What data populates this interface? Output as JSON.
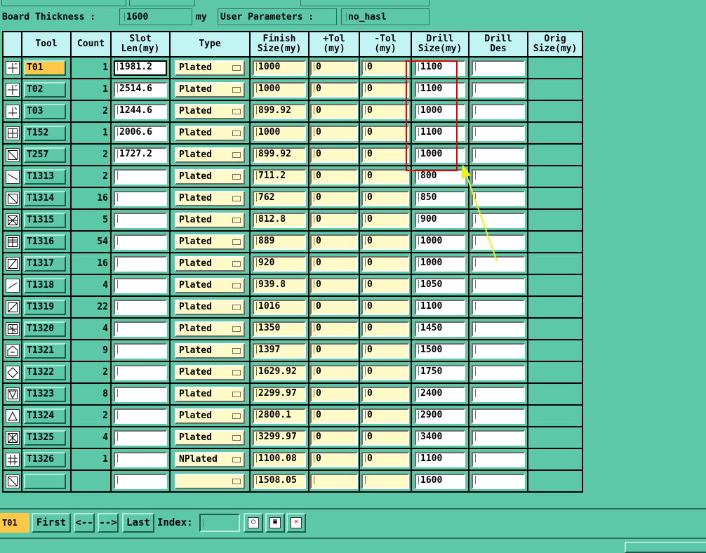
{
  "params": {
    "board_thickness_label": "Board Thickness :",
    "board_thickness_value": "1600",
    "board_thickness_unit": "my",
    "user_params_label": "User Parameters :",
    "user_params_value": "no_hasl"
  },
  "columns": [
    "",
    "Tool",
    "Count",
    "Slot\nLen(my)",
    "Type",
    "Finish\nSize(my)",
    "+Tol\n(my)",
    "-Tol\n(my)",
    "Drill\nSize(my)",
    "Drill\nDes",
    "Orig\nSize(my)"
  ],
  "rows": [
    {
      "icon": "crosshair-icon",
      "tool": "T01",
      "count": "1",
      "slot": "1981.2",
      "type": "Plated",
      "finish": "1000",
      "ptol": "0",
      "mtol": "0",
      "drill": "1100",
      "des": "",
      "selected": true
    },
    {
      "icon": "crosshair-icon",
      "tool": "T02",
      "count": "1",
      "slot": "2514.6",
      "type": "Plated",
      "finish": "1000",
      "ptol": "0",
      "mtol": "0",
      "drill": "1100",
      "des": ""
    },
    {
      "icon": "corner-icon",
      "tool": "T03",
      "count": "2",
      "slot": "1244.6",
      "type": "Plated",
      "finish": "899.92",
      "ptol": "0",
      "mtol": "0",
      "drill": "1000",
      "des": ""
    },
    {
      "icon": "box-cross-icon",
      "tool": "T152",
      "count": "1",
      "slot": "2006.6",
      "type": "Plated",
      "finish": "1000",
      "ptol": "0",
      "mtol": "0",
      "drill": "1100",
      "des": ""
    },
    {
      "icon": "diag-icon",
      "tool": "T257",
      "count": "2",
      "slot": "1727.2",
      "type": "Plated",
      "finish": "899.92",
      "ptol": "0",
      "mtol": "0",
      "drill": "1000",
      "des": ""
    },
    {
      "icon": "slash-icon",
      "tool": "T1313",
      "count": "2",
      "slot": "",
      "type": "Plated",
      "finish": "711.2",
      "ptol": "0",
      "mtol": "0",
      "drill": "800",
      "des": ""
    },
    {
      "icon": "box-diag-icon",
      "tool": "T1314",
      "count": "16",
      "slot": "",
      "type": "Plated",
      "finish": "762",
      "ptol": "0",
      "mtol": "0",
      "drill": "850",
      "des": ""
    },
    {
      "icon": "box-x-icon",
      "tool": "T1315",
      "count": "5",
      "slot": "",
      "type": "Plated",
      "finish": "812.8",
      "ptol": "0",
      "mtol": "0",
      "drill": "900",
      "des": ""
    },
    {
      "icon": "box-grid-icon",
      "tool": "T1316",
      "count": "54",
      "slot": "",
      "type": "Plated",
      "finish": "889",
      "ptol": "0",
      "mtol": "0",
      "drill": "1000",
      "des": ""
    },
    {
      "icon": "slash-up-icon",
      "tool": "T1317",
      "count": "16",
      "slot": "",
      "type": "Plated",
      "finish": "920",
      "ptol": "0",
      "mtol": "0",
      "drill": "1000",
      "des": ""
    },
    {
      "icon": "line-icon",
      "tool": "T1318",
      "count": "4",
      "slot": "",
      "type": "Plated",
      "finish": "939.8",
      "ptol": "0",
      "mtol": "0",
      "drill": "1050",
      "des": ""
    },
    {
      "icon": "box-slash-icon",
      "tool": "T1319",
      "count": "22",
      "slot": "",
      "type": "Plated",
      "finish": "1016",
      "ptol": "0",
      "mtol": "0",
      "drill": "1100",
      "des": ""
    },
    {
      "icon": "box-plus-icon",
      "tool": "T1320",
      "count": "4",
      "slot": "",
      "type": "Plated",
      "finish": "1350",
      "ptol": "0",
      "mtol": "0",
      "drill": "1450",
      "des": ""
    },
    {
      "icon": "house-icon",
      "tool": "T1321",
      "count": "9",
      "slot": "",
      "type": "Plated",
      "finish": "1397",
      "ptol": "0",
      "mtol": "0",
      "drill": "1500",
      "des": ""
    },
    {
      "icon": "diamond-icon",
      "tool": "T1322",
      "count": "2",
      "slot": "",
      "type": "Plated",
      "finish": "1629.92",
      "ptol": "0",
      "mtol": "0",
      "drill": "1750",
      "des": ""
    },
    {
      "icon": "triangle-down-icon",
      "tool": "T1323",
      "count": "8",
      "slot": "",
      "type": "Plated",
      "finish": "2299.97",
      "ptol": "0",
      "mtol": "0",
      "drill": "2400",
      "des": ""
    },
    {
      "icon": "triangle-up-icon",
      "tool": "T1324",
      "count": "2",
      "slot": "",
      "type": "Plated",
      "finish": "2800.1",
      "ptol": "0",
      "mtol": "0",
      "drill": "2900",
      "des": ""
    },
    {
      "icon": "star-icon",
      "tool": "T1325",
      "count": "4",
      "slot": "",
      "type": "Plated",
      "finish": "3299.97",
      "ptol": "0",
      "mtol": "0",
      "drill": "3400",
      "des": ""
    },
    {
      "icon": "hash-icon",
      "tool": "T1326",
      "count": "1",
      "slot": "",
      "type": "NPlated",
      "finish": "1100.08",
      "ptol": "0",
      "mtol": "0",
      "drill": "1100",
      "des": ""
    },
    {
      "icon": "partial-icon",
      "tool": "",
      "count": "",
      "slot": "",
      "type": "",
      "finish": "1508.05",
      "ptol": "",
      "mtol": "",
      "drill": "1600",
      "des": ""
    }
  ],
  "bottom": {
    "current_tool": "T01",
    "first_label": "First",
    "prev_label": "<--",
    "next_label": "-->",
    "last_label": "Last",
    "index_label": "Index:",
    "index_value": ""
  },
  "colors": {
    "background": "#5cc8a8",
    "header": "#c2f4f4",
    "selected": "#ffc848",
    "input_yellow": "#fffac8",
    "highlight_box": "#e00000",
    "arrow": "#f0f020"
  }
}
